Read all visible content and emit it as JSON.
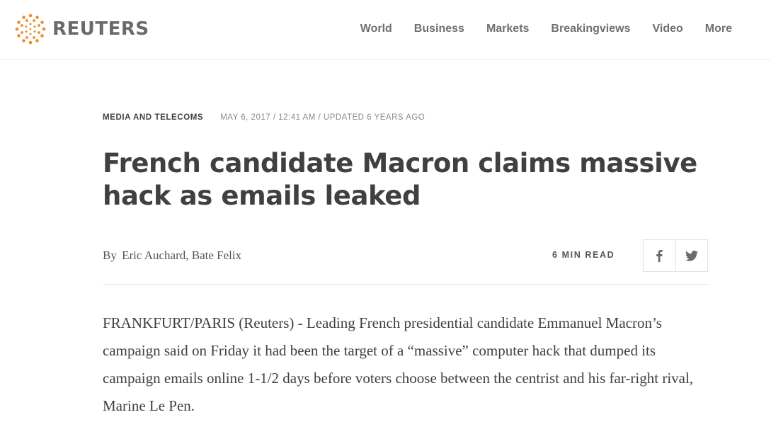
{
  "header": {
    "logo_text": "REUTERS",
    "nav": [
      "World",
      "Business",
      "Markets",
      "Breakingviews",
      "Video",
      "More"
    ]
  },
  "article": {
    "section": "MEDIA AND TELECOMS",
    "date": "MAY 6, 2017 / 12:41 AM / UPDATED 6 YEARS AGO",
    "title": "French candidate Macron claims massive hack as emails leaked",
    "byline_prefix": "By",
    "authors": "Eric Auchard, Bate Felix",
    "read_time": "6 MIN READ",
    "share": [
      "facebook-icon",
      "twitter-icon"
    ],
    "body": "FRANKFURT/PARIS (Reuters) - Leading French presidential candidate Emmanuel Macron’s campaign said on Friday it had been the target of a “massive” computer hack that dumped its campaign emails online 1-1/2 days before voters choose between the centrist and his far-right rival, Marine Le Pen."
  },
  "colors": {
    "brand_orange": "#f08a2c",
    "text_dark": "#404040",
    "text_muted": "#8a8a8a",
    "divider": "#e6e6e6"
  }
}
